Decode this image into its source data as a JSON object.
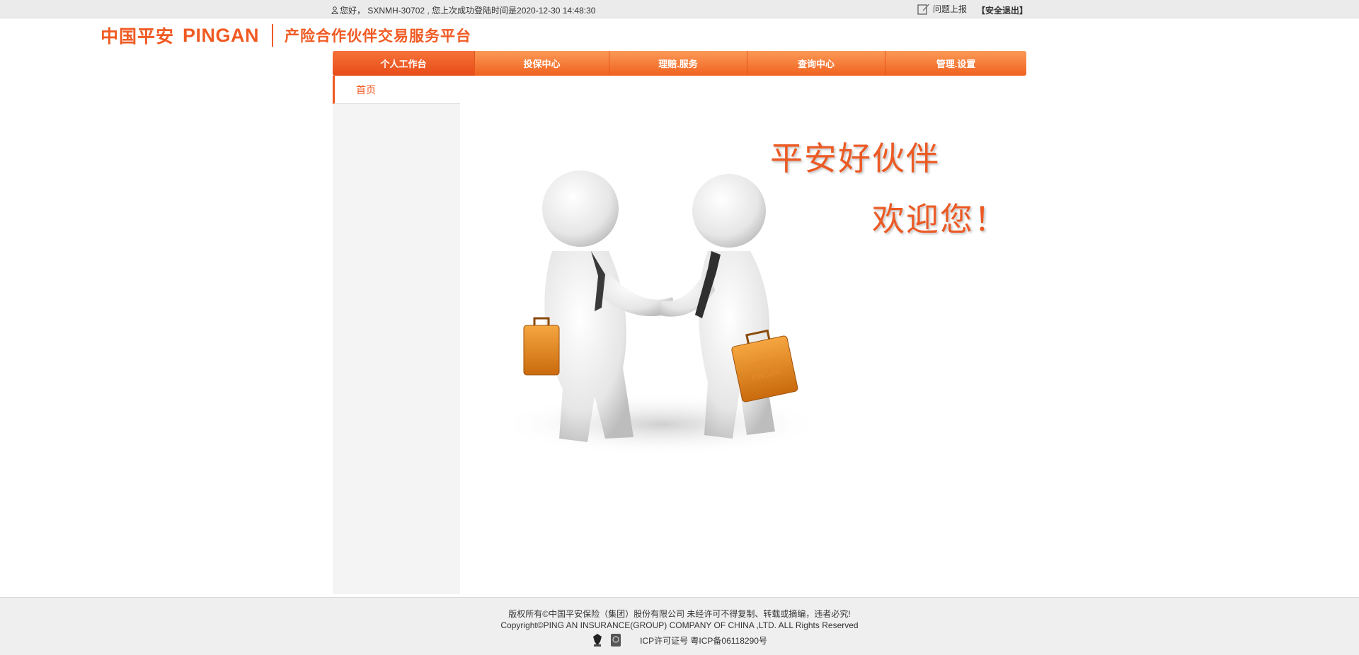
{
  "topbar": {
    "greeting": "您好， SXNMH-30702 , 您上次成功登陆时间是2020-12-30 14:48:30",
    "report_label": "问题上报",
    "logout_label": "【安全退出】"
  },
  "logo": {
    "cn": "中国平安",
    "en": "PINGAN",
    "platform": "产险合作伙伴交易服务平台",
    "brand_color": "#f05a23"
  },
  "nav": {
    "tabs": [
      {
        "label": "个人工作台",
        "active": true
      },
      {
        "label": "投保中心",
        "active": false
      },
      {
        "label": "理赔.服务",
        "active": false
      },
      {
        "label": "查询中心",
        "active": false
      },
      {
        "label": "管理.设置",
        "active": false
      }
    ]
  },
  "sidebar": {
    "home_label": "首页"
  },
  "welcome": {
    "line1": "平安好伙伴",
    "line2": "欢迎您！",
    "briefcase_text1": "中国平安",
    "briefcase_text2": "PINGAN"
  },
  "footer": {
    "copyright_cn": "版权所有©中国平安保险（集团）股份有限公司 未经许可不得复制、转载或摘编，违者必究!",
    "copyright_en": "Copyright©PING AN INSURANCE(GROUP) COMPANY OF CHINA ,LTD. ALL Rights Reserved",
    "icp": "ICP许可证号 粤ICP备06118290号"
  }
}
